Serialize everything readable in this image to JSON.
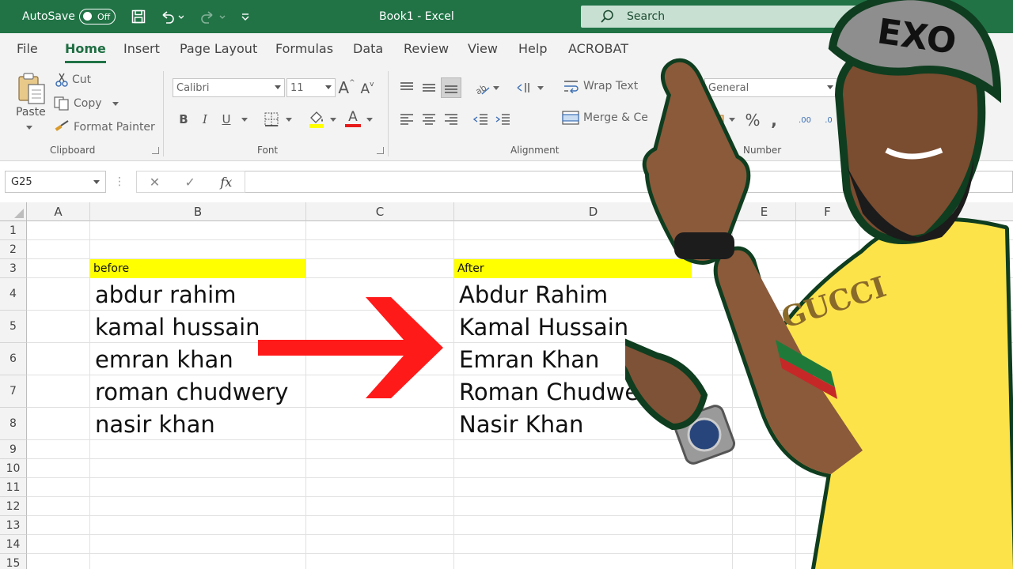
{
  "titlebar": {
    "autosave_label": "AutoSave",
    "autosave_state": "Off",
    "window_title": "Book1  -  Excel",
    "search_placeholder": "Search"
  },
  "tabs": [
    "File",
    "Home",
    "Insert",
    "Page Layout",
    "Formulas",
    "Data",
    "Review",
    "View",
    "Help",
    "ACROBAT"
  ],
  "active_tab": "Home",
  "ribbon": {
    "clipboard": {
      "paste": "Paste",
      "cut": "Cut",
      "copy": "Copy",
      "format_painter": "Format Painter",
      "label": "Clipboard"
    },
    "font": {
      "font_name": "Calibri",
      "font_size": "11",
      "label": "Font"
    },
    "alignment": {
      "wrap_text": "Wrap Text",
      "merge": "Merge & Ce",
      "label": "Alignment"
    },
    "number": {
      "format": "General",
      "label": "Number"
    }
  },
  "formula_bar": {
    "name_box": "G25",
    "fx": "fx"
  },
  "columns": [
    "A",
    "B",
    "C",
    "D",
    "E",
    "F"
  ],
  "rows": [
    "1",
    "2",
    "3",
    "4",
    "5",
    "6",
    "7",
    "8",
    "9",
    "10",
    "11",
    "12",
    "13",
    "14",
    "15"
  ],
  "sheet": {
    "before_header": "before",
    "after_header": "After",
    "before": [
      "abdur rahim",
      "kamal hussain",
      "emran khan",
      "roman chudwery",
      "nasir khan"
    ],
    "after": [
      "Abdur Rahim",
      "Kamal Hussain",
      "Emran Khan",
      "Roman Chudwery",
      "Nasir Khan"
    ]
  },
  "overlay": {
    "cap_text": "EXO",
    "shirt_text": "GUCCI",
    "arrow_color": "#ff1a1a",
    "shirt_color": "#fde34a",
    "excel_green": "#217346"
  }
}
